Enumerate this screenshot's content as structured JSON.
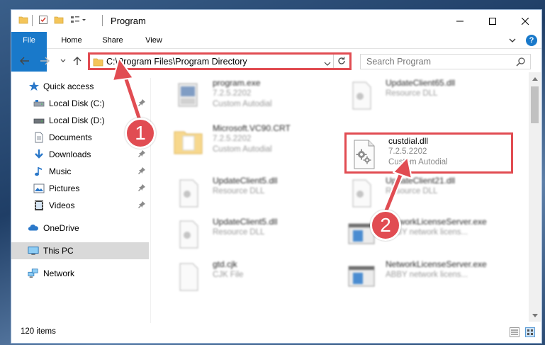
{
  "window": {
    "title": "Program",
    "controls": {
      "minimize": "–",
      "maximize": "☐",
      "close": "✕"
    }
  },
  "ribbon": {
    "tabs": [
      "File",
      "Home",
      "Share",
      "View"
    ],
    "help": "?"
  },
  "address": {
    "path": "C:\\Program Files\\Program Directory"
  },
  "search": {
    "placeholder": "Search Program"
  },
  "sidebar": {
    "items": [
      {
        "label": "Quick access",
        "icon": "star-icon"
      },
      {
        "label": "Local Disk (C:)",
        "icon": "drive-icon",
        "pinned": true
      },
      {
        "label": "Local Disk (D:)",
        "icon": "drive-icon",
        "pinned": false
      },
      {
        "label": "Documents",
        "icon": "documents-icon",
        "pinned": true
      },
      {
        "label": "Downloads",
        "icon": "download-icon",
        "pinned": true
      },
      {
        "label": "Music",
        "icon": "music-icon",
        "pinned": true
      },
      {
        "label": "Pictures",
        "icon": "pictures-icon",
        "pinned": true
      },
      {
        "label": "Videos",
        "icon": "videos-icon",
        "pinned": true
      },
      {
        "label": "OneDrive",
        "icon": "cloud-icon"
      },
      {
        "label": "This PC",
        "icon": "computer-icon",
        "selected": true
      },
      {
        "label": "Network",
        "icon": "network-icon"
      }
    ]
  },
  "files": [
    {
      "name": "program.exe",
      "line2": "7.2.5.2202",
      "line3": "Custom Autodial",
      "icon": "exe-icon"
    },
    {
      "name": "UpdateClient65.dll",
      "line2": "Resource DLL",
      "line3": "",
      "icon": "dll-icon"
    },
    {
      "name": "Microsoft.VC90.CRT",
      "line2": "7.2.5.2202",
      "line3": "Custom Autodial",
      "icon": "folder-icon"
    },
    {
      "name": "custdial.dll",
      "line2": "7.2.5.2202",
      "line3": "Custom Autodial",
      "icon": "gear-dll-icon"
    },
    {
      "name": "UpdateClient5.dll",
      "line2": "Resource DLL",
      "line3": "",
      "icon": "dll-icon"
    },
    {
      "name": "UpdateClient21.dll",
      "line2": "Resource DLL",
      "line3": "",
      "icon": "dll-icon"
    },
    {
      "name": "UpdateClient5.dll",
      "line2": "Resource DLL",
      "line3": "",
      "icon": "dll-icon"
    },
    {
      "name": "NetworkLicenseServer.exe",
      "line2": "ABBY network licens...",
      "line3": "",
      "icon": "app-icon"
    },
    {
      "name": "gtd.cjk",
      "line2": "CJK File",
      "line3": "",
      "icon": "file-icon"
    },
    {
      "name": "NetworkLicenseServer.exe",
      "line2": "ABBY network licens...",
      "line3": "",
      "icon": "app-icon"
    }
  ],
  "status": {
    "items_count": "120 items"
  },
  "callouts": [
    "1",
    "2"
  ],
  "colors": {
    "accent": "#1979ca",
    "highlight": "#e14c52"
  }
}
